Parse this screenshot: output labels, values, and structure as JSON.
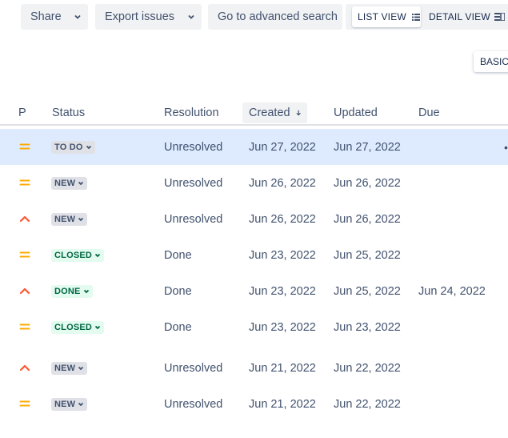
{
  "toolbar": {
    "share_label": "Share",
    "export_label": "Export issues",
    "advanced_label": "Go to advanced search",
    "list_view_label": "LIST VIEW",
    "detail_view_label": "DETAIL VIEW",
    "basic_label": "BASIC"
  },
  "columns": {
    "p": "P",
    "status": "Status",
    "resolution": "Resolution",
    "created": "Created",
    "updated": "Updated",
    "due": "Due"
  },
  "colors": {
    "priority_medium": "#ffab00",
    "priority_high": "#ff5630",
    "selected_row": "#deebff",
    "lozenge_grey": "#dfe1e6",
    "lozenge_green": "#e3fcef"
  },
  "rows": [
    {
      "priority": "medium",
      "priority_icon": "priority-medium-icon",
      "status": "TO DO",
      "status_style": "grey",
      "resolution": "Unresolved",
      "created": "Jun 27, 2022",
      "updated": "Jun 27, 2022",
      "due": "",
      "selected": true
    },
    {
      "priority": "medium",
      "priority_icon": "priority-medium-icon",
      "status": "NEW",
      "status_style": "grey",
      "resolution": "Unresolved",
      "created": "Jun 26, 2022",
      "updated": "Jun 26, 2022",
      "due": ""
    },
    {
      "priority": "high",
      "priority_icon": "priority-high-icon",
      "status": "NEW",
      "status_style": "grey",
      "resolution": "Unresolved",
      "created": "Jun 26, 2022",
      "updated": "Jun 26, 2022",
      "due": ""
    },
    {
      "priority": "medium",
      "priority_icon": "priority-medium-icon",
      "status": "CLOSED",
      "status_style": "green",
      "resolution": "Done",
      "created": "Jun 23, 2022",
      "updated": "Jun 25, 2022",
      "due": ""
    },
    {
      "priority": "high",
      "priority_icon": "priority-high-icon",
      "status": "DONE",
      "status_style": "green",
      "resolution": "Done",
      "created": "Jun 23, 2022",
      "updated": "Jun 25, 2022",
      "due": "Jun 24, 2022"
    },
    {
      "priority": "medium",
      "priority_icon": "priority-medium-icon",
      "status": "CLOSED",
      "status_style": "green",
      "resolution": "Done",
      "created": "Jun 23, 2022",
      "updated": "Jun 23, 2022",
      "due": ""
    },
    {
      "priority": "high",
      "priority_icon": "priority-high-icon",
      "status": "NEW",
      "status_style": "grey",
      "resolution": "Unresolved",
      "created": "Jun 21, 2022",
      "updated": "Jun 22, 2022",
      "due": ""
    },
    {
      "priority": "medium",
      "priority_icon": "priority-medium-icon",
      "status": "NEW",
      "status_style": "grey",
      "resolution": "Unresolved",
      "created": "Jun 21, 2022",
      "updated": "Jun 22, 2022",
      "due": ""
    }
  ]
}
